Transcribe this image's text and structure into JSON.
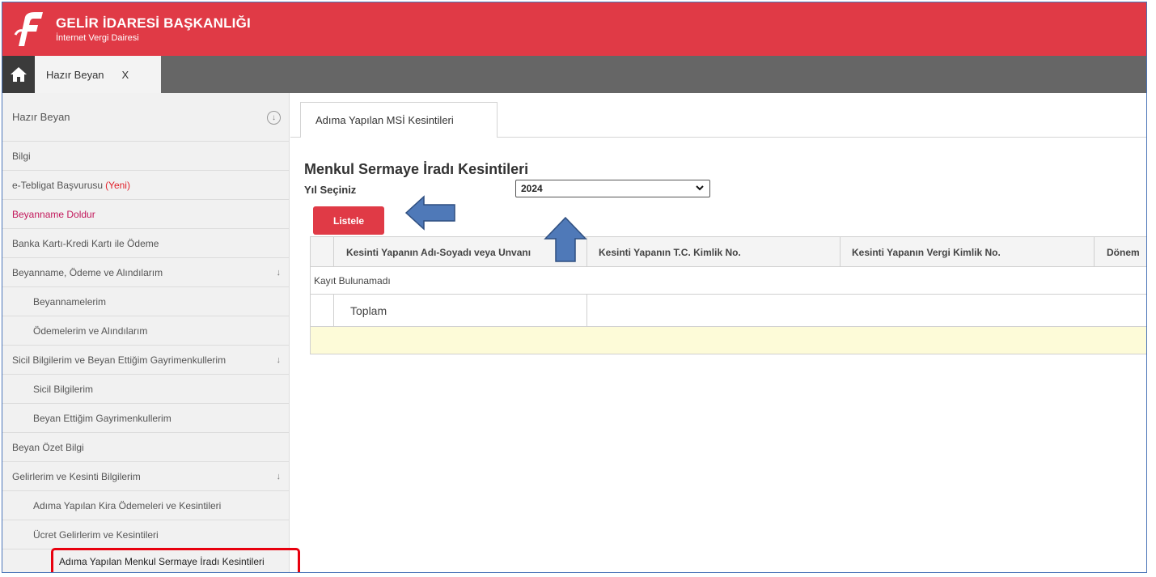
{
  "header": {
    "title": "GELİR İDARESİ BAŞKANLIĞI",
    "subtitle": "İnternet Vergi Dairesi",
    "logo_icon": "gib-logo-icon",
    "color": "#e03a46"
  },
  "tabbar": {
    "home_icon": "home-icon",
    "open_tab_label": "Hazır Beyan",
    "open_tab_close": "X"
  },
  "sidebar": {
    "header": "Hazır Beyan",
    "items": [
      {
        "label": "Bilgi"
      },
      {
        "label": "e-Tebligat Başvurusu",
        "badge": "(Yeni)"
      },
      {
        "label": "Beyanname Doldur"
      },
      {
        "label": "Banka Kartı-Kredi Kartı ile Ödeme"
      },
      {
        "label": "Beyanname, Ödeme ve Alındılarım",
        "arrow": "↓"
      },
      {
        "label": "Beyannamelerim"
      },
      {
        "label": "Ödemelerim ve Alındılarım"
      },
      {
        "label": "Sicil Bilgilerim ve Beyan Ettiğim Gayrimenkullerim",
        "arrow": "↓"
      },
      {
        "label": "Sicil Bilgilerim"
      },
      {
        "label": "Beyan Ettiğim Gayrimenkullerim"
      },
      {
        "label": "Beyan Özet Bilgi"
      },
      {
        "label": "Gelirlerim ve Kesinti Bilgilerim",
        "arrow": "↓"
      },
      {
        "label": "Adıma Yapılan Kira Ödemeleri ve Kesintileri"
      },
      {
        "label": "Ücret Gelirlerim ve Kesintileri"
      },
      {
        "label": "Adıma Yapılan Menkul Sermaye İradı Kesintileri"
      }
    ]
  },
  "main": {
    "tab_label": "Adıma Yapılan MSİ Kesintileri",
    "page_title": "Menkul Sermaye İradı Kesintileri",
    "year_label": "Yıl Seçiniz",
    "year_value": "2024",
    "list_button": "Listele",
    "columns": [
      "Kesinti Yapanın Adı-Soyadı veya Unvanı",
      "Kesinti Yapanın T.C. Kimlik No.",
      "Kesinti Yapanın Vergi Kimlik No.",
      "Dönem"
    ],
    "empty_text": "Kayıt Bulunamadı",
    "total_label": "Toplam"
  },
  "annotations": {
    "highlight_color": "#e8000e",
    "arrow_color": "#4f79b8"
  }
}
